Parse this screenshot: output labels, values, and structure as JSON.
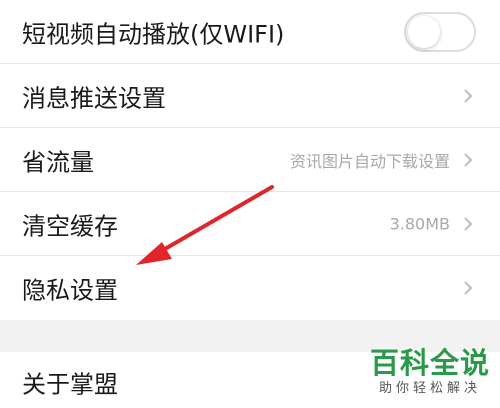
{
  "settings": {
    "autoplay": {
      "label": "短视频自动播放(仅WIFI)",
      "enabled": false
    },
    "push": {
      "label": "消息推送设置"
    },
    "data_saver": {
      "label": "省流量",
      "value": "资讯图片自动下载设置"
    },
    "cache": {
      "label": "清空缓存",
      "value": "3.80MB"
    },
    "privacy": {
      "label": "隐私设置"
    },
    "about": {
      "label": "关于掌盟"
    }
  },
  "annotation": {
    "arrow_color": "#e0262a"
  },
  "watermark": {
    "title": "百科全说",
    "subtitle": "助你轻松解决"
  },
  "colors": {
    "brand_green": "#2a9a4a",
    "chevron": "#bbbbbb"
  }
}
